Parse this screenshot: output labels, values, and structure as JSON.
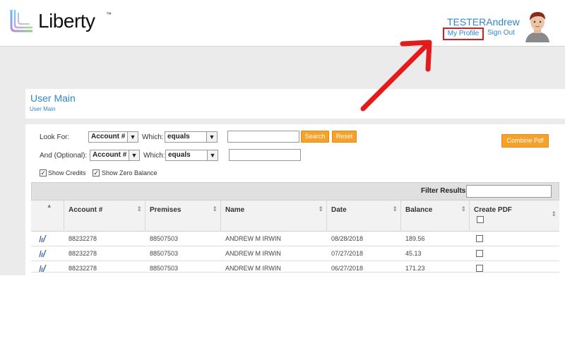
{
  "header": {
    "logo_text": "Liberty",
    "logo_tm": "™",
    "user_name": "TESTERAndrew",
    "my_profile": "My Profile",
    "sign_out": "Sign Out"
  },
  "page": {
    "title": "User Main",
    "breadcrumb": "User Main"
  },
  "search": {
    "look_for_label": "Look For:",
    "and_optional_label": "And (Optional):",
    "which_label": "Which:",
    "field1_value": "Account #",
    "field2_value": "Account #",
    "operator1_value": "equals",
    "operator2_value": "equals",
    "search_button": "Search",
    "reset_button": "Reset",
    "combine_pdf_button": "Combine Pdf",
    "show_credits_label": "Show Credits",
    "show_zero_balance_label": "Show Zero Balance"
  },
  "filter": {
    "label": "Filter Results:"
  },
  "table": {
    "columns": [
      "Account #",
      "Premises",
      "Name",
      "Date",
      "Balance",
      "Create PDF"
    ],
    "rows": [
      {
        "account": "88232278",
        "premises": "88507503",
        "name": "ANDREW M IRWIN",
        "date": "08/28/2018",
        "balance": "189.56"
      },
      {
        "account": "88232278",
        "premises": "88507503",
        "name": "ANDREW M IRWIN",
        "date": "07/27/2018",
        "balance": "45.13"
      },
      {
        "account": "88232278",
        "premises": "88507503",
        "name": "ANDREW M IRWIN",
        "date": "06/27/2018",
        "balance": "171.23"
      }
    ]
  },
  "colors": {
    "link_blue": "#2f86c8",
    "accent_orange": "#f6a12a",
    "annotation_red": "#e41b1b"
  }
}
